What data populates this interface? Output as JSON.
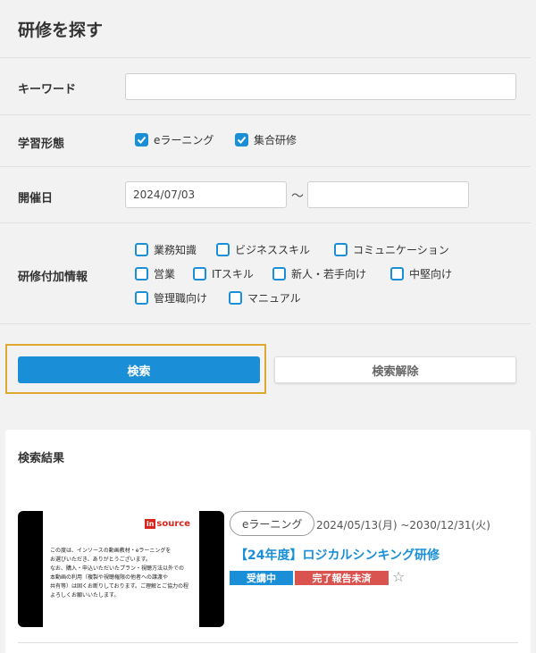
{
  "page": {
    "title": "研修を探す"
  },
  "keyword": {
    "label": "キーワード",
    "value": ""
  },
  "learning_format": {
    "label": "学習形態",
    "options": [
      {
        "label": "eラーニング",
        "checked": true
      },
      {
        "label": "集合研修",
        "checked": true
      }
    ]
  },
  "date": {
    "label": "開催日",
    "from": "2024/07/03",
    "separator": "〜",
    "to": ""
  },
  "extra_info": {
    "label": "研修付加情報",
    "options": [
      {
        "label": "業務知識",
        "checked": false
      },
      {
        "label": "ビジネススキル",
        "checked": false
      },
      {
        "label": "コミュニケーション",
        "checked": false
      },
      {
        "label": "営業",
        "checked": false
      },
      {
        "label": "ITスキル",
        "checked": false
      },
      {
        "label": "新人・若手向け",
        "checked": false
      },
      {
        "label": "中堅向け",
        "checked": false
      },
      {
        "label": "管理職向け",
        "checked": false
      },
      {
        "label": "マニュアル",
        "checked": false
      }
    ]
  },
  "actions": {
    "search": "検索",
    "clear": "検索解除"
  },
  "results": {
    "title": "検索結果",
    "items": [
      {
        "thumbnail": {
          "logo_mark": "in",
          "logo_text": "source",
          "text_lines": [
            "この度は、インソースの動画教材・eラーニングを",
            "お選びいただき、ありがとうございます。",
            "なお、購入・申込いただいたプラン・視聴方法以外での",
            "本動画の利用（複製や視聴権限の他者への譲渡や",
            "共有等）は固くお断りしております。ご理解とご協力の程",
            "よろしくお願いいたします。"
          ]
        },
        "format": "eラーニング",
        "period": "2024/05/13(月) ~2030/12/31(火)",
        "title": "【24年度】ロジカルシンキング研修",
        "status": "受講中",
        "report": "完了報告未済",
        "favorite_icon": "star-outline-icon"
      }
    ]
  },
  "colors": {
    "accent": "#1a8fd8",
    "danger": "#d9534f",
    "highlight": "#e0a82e"
  }
}
